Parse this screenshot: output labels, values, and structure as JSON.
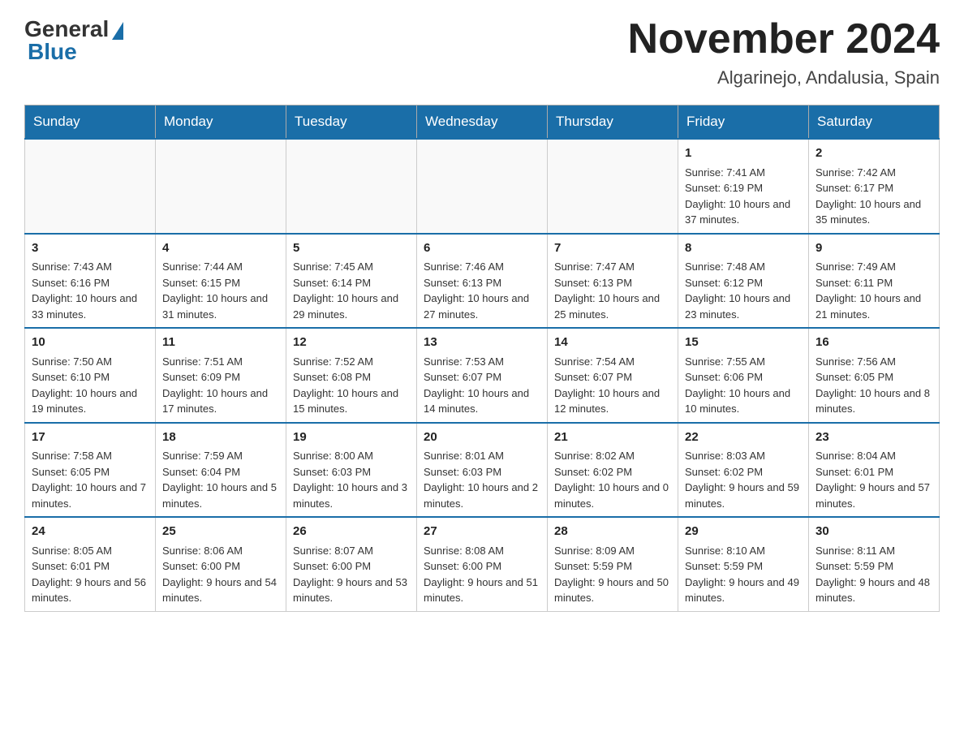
{
  "logo": {
    "general": "General",
    "blue": "Blue"
  },
  "title": "November 2024",
  "location": "Algarinejo, Andalusia, Spain",
  "days_of_week": [
    "Sunday",
    "Monday",
    "Tuesday",
    "Wednesday",
    "Thursday",
    "Friday",
    "Saturday"
  ],
  "weeks": [
    [
      {
        "day": "",
        "info": ""
      },
      {
        "day": "",
        "info": ""
      },
      {
        "day": "",
        "info": ""
      },
      {
        "day": "",
        "info": ""
      },
      {
        "day": "",
        "info": ""
      },
      {
        "day": "1",
        "info": "Sunrise: 7:41 AM\nSunset: 6:19 PM\nDaylight: 10 hours and 37 minutes."
      },
      {
        "day": "2",
        "info": "Sunrise: 7:42 AM\nSunset: 6:17 PM\nDaylight: 10 hours and 35 minutes."
      }
    ],
    [
      {
        "day": "3",
        "info": "Sunrise: 7:43 AM\nSunset: 6:16 PM\nDaylight: 10 hours and 33 minutes."
      },
      {
        "day": "4",
        "info": "Sunrise: 7:44 AM\nSunset: 6:15 PM\nDaylight: 10 hours and 31 minutes."
      },
      {
        "day": "5",
        "info": "Sunrise: 7:45 AM\nSunset: 6:14 PM\nDaylight: 10 hours and 29 minutes."
      },
      {
        "day": "6",
        "info": "Sunrise: 7:46 AM\nSunset: 6:13 PM\nDaylight: 10 hours and 27 minutes."
      },
      {
        "day": "7",
        "info": "Sunrise: 7:47 AM\nSunset: 6:13 PM\nDaylight: 10 hours and 25 minutes."
      },
      {
        "day": "8",
        "info": "Sunrise: 7:48 AM\nSunset: 6:12 PM\nDaylight: 10 hours and 23 minutes."
      },
      {
        "day": "9",
        "info": "Sunrise: 7:49 AM\nSunset: 6:11 PM\nDaylight: 10 hours and 21 minutes."
      }
    ],
    [
      {
        "day": "10",
        "info": "Sunrise: 7:50 AM\nSunset: 6:10 PM\nDaylight: 10 hours and 19 minutes."
      },
      {
        "day": "11",
        "info": "Sunrise: 7:51 AM\nSunset: 6:09 PM\nDaylight: 10 hours and 17 minutes."
      },
      {
        "day": "12",
        "info": "Sunrise: 7:52 AM\nSunset: 6:08 PM\nDaylight: 10 hours and 15 minutes."
      },
      {
        "day": "13",
        "info": "Sunrise: 7:53 AM\nSunset: 6:07 PM\nDaylight: 10 hours and 14 minutes."
      },
      {
        "day": "14",
        "info": "Sunrise: 7:54 AM\nSunset: 6:07 PM\nDaylight: 10 hours and 12 minutes."
      },
      {
        "day": "15",
        "info": "Sunrise: 7:55 AM\nSunset: 6:06 PM\nDaylight: 10 hours and 10 minutes."
      },
      {
        "day": "16",
        "info": "Sunrise: 7:56 AM\nSunset: 6:05 PM\nDaylight: 10 hours and 8 minutes."
      }
    ],
    [
      {
        "day": "17",
        "info": "Sunrise: 7:58 AM\nSunset: 6:05 PM\nDaylight: 10 hours and 7 minutes."
      },
      {
        "day": "18",
        "info": "Sunrise: 7:59 AM\nSunset: 6:04 PM\nDaylight: 10 hours and 5 minutes."
      },
      {
        "day": "19",
        "info": "Sunrise: 8:00 AM\nSunset: 6:03 PM\nDaylight: 10 hours and 3 minutes."
      },
      {
        "day": "20",
        "info": "Sunrise: 8:01 AM\nSunset: 6:03 PM\nDaylight: 10 hours and 2 minutes."
      },
      {
        "day": "21",
        "info": "Sunrise: 8:02 AM\nSunset: 6:02 PM\nDaylight: 10 hours and 0 minutes."
      },
      {
        "day": "22",
        "info": "Sunrise: 8:03 AM\nSunset: 6:02 PM\nDaylight: 9 hours and 59 minutes."
      },
      {
        "day": "23",
        "info": "Sunrise: 8:04 AM\nSunset: 6:01 PM\nDaylight: 9 hours and 57 minutes."
      }
    ],
    [
      {
        "day": "24",
        "info": "Sunrise: 8:05 AM\nSunset: 6:01 PM\nDaylight: 9 hours and 56 minutes."
      },
      {
        "day": "25",
        "info": "Sunrise: 8:06 AM\nSunset: 6:00 PM\nDaylight: 9 hours and 54 minutes."
      },
      {
        "day": "26",
        "info": "Sunrise: 8:07 AM\nSunset: 6:00 PM\nDaylight: 9 hours and 53 minutes."
      },
      {
        "day": "27",
        "info": "Sunrise: 8:08 AM\nSunset: 6:00 PM\nDaylight: 9 hours and 51 minutes."
      },
      {
        "day": "28",
        "info": "Sunrise: 8:09 AM\nSunset: 5:59 PM\nDaylight: 9 hours and 50 minutes."
      },
      {
        "day": "29",
        "info": "Sunrise: 8:10 AM\nSunset: 5:59 PM\nDaylight: 9 hours and 49 minutes."
      },
      {
        "day": "30",
        "info": "Sunrise: 8:11 AM\nSunset: 5:59 PM\nDaylight: 9 hours and 48 minutes."
      }
    ]
  ]
}
